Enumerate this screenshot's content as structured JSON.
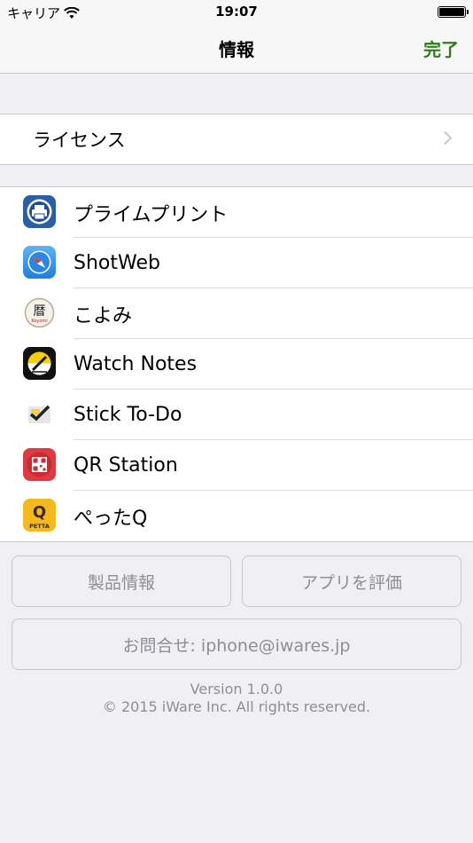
{
  "status_bar": {
    "carrier": "キャリア",
    "time": "19:07"
  },
  "nav": {
    "title": "情報",
    "done_label": "完了"
  },
  "license": {
    "label": "ライセンス"
  },
  "apps": [
    {
      "label": "プライムプリント",
      "icon": "printer-icon"
    },
    {
      "label": "ShotWeb",
      "icon": "compass-icon"
    },
    {
      "label": "こよみ",
      "icon": "calendar-reki-icon"
    },
    {
      "label": "Watch Notes",
      "icon": "pencil-note-icon"
    },
    {
      "label": "Stick To-Do",
      "icon": "checkmark-icon"
    },
    {
      "label": "QR Station",
      "icon": "qr-code-icon"
    },
    {
      "label": "ぺったQ",
      "icon": "petta-q-icon"
    }
  ],
  "icon_text": {
    "koyomi": "暦",
    "koyomi_sub": "Koyomi",
    "petta_q": "Q",
    "petta": "PETTA"
  },
  "buttons": {
    "product_info": "製品情報",
    "rate_app": "アプリを評価",
    "contact": "お問合せ: iphone@iwares.jp"
  },
  "footer": {
    "version": "Version 1.0.0",
    "copyright": "© 2015 iWare Inc. All rights reserved."
  },
  "colors": {
    "accent": "#2e7d1a",
    "background": "#efeff4",
    "button_text": "#8e8e93"
  }
}
